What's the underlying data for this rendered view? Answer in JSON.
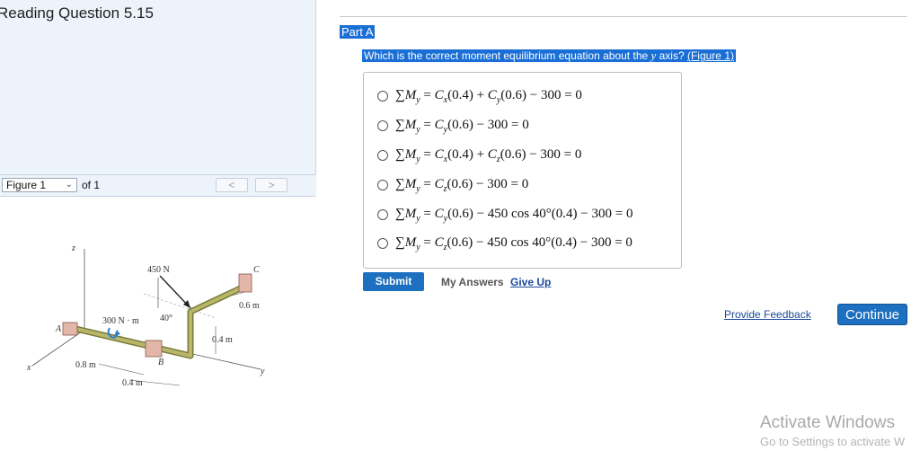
{
  "left_panel": {
    "title": "Reading Question 5.15",
    "figure_bar": {
      "select_value": "Figure 1",
      "of_text": "of 1",
      "prev_glyph": "<",
      "next_glyph": ">"
    },
    "figure_labels": {
      "z": "z",
      "x": "x",
      "y": "y",
      "A": "A",
      "B": "B",
      "C": "C",
      "force": "450 N",
      "moment": "300 N · m",
      "angle": "40°",
      "d1": "0.6 m",
      "d2": "0.4 m",
      "d3": "0.8 m",
      "d4": "0.4 m"
    }
  },
  "part": {
    "label": "Part A",
    "question_prefix": "Which is the correct moment equilibrium equation about the ",
    "question_var": "y",
    "question_mid": " axis? ",
    "question_link": "(Figure 1)"
  },
  "options": [
    "∑M_y = C_x(0.4) + C_y(0.6) − 300 = 0",
    "∑M_y = C_y(0.6) − 300 = 0",
    "∑M_y = C_x(0.4) + C_z(0.6) − 300 = 0",
    "∑M_y = C_z(0.6) − 300 = 0",
    "∑M_y = C_y(0.6) − 450 cos 40°(0.4) − 300 = 0",
    "∑M_y = C_z(0.6) − 450 cos 40°(0.4) − 300 = 0"
  ],
  "actions": {
    "submit": "Submit",
    "my_answers": "My Answers",
    "give_up": "Give Up",
    "provide_feedback": "Provide Feedback",
    "continue": "Continue"
  },
  "watermark": {
    "line1": "Activate Windows",
    "line2": "Go to Settings to activate W"
  },
  "colors": {
    "accent": "#1a6fd6",
    "button": "#1d6fbf",
    "link": "#1a4a9a",
    "panel_bg": "#edf3fa"
  }
}
